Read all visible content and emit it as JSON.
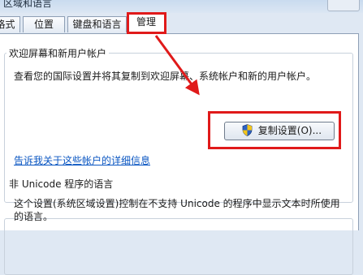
{
  "window": {
    "title": "区域和语言"
  },
  "tabs": [
    {
      "label": "格式"
    },
    {
      "label": "位置"
    },
    {
      "label": "键盘和语言"
    },
    {
      "label": "管理",
      "active": true
    }
  ],
  "welcome_group": {
    "title": "欢迎屏幕和新用户帐户",
    "description": "查看您的国际设置并将其复制到欢迎屏幕、系统帐户和新的用户帐户。",
    "copy_button_label": "复制设置(O)...",
    "details_link": "告诉我关于这些帐户的详细信息"
  },
  "unicode_group": {
    "title": "非 Unicode 程序的语言",
    "description": "这个设置(系统区域设置)控制在不支持 Unicode 的程序中显示文本时所使用的语言。"
  },
  "annotations": {
    "highlight_color": "#e01a1a"
  }
}
